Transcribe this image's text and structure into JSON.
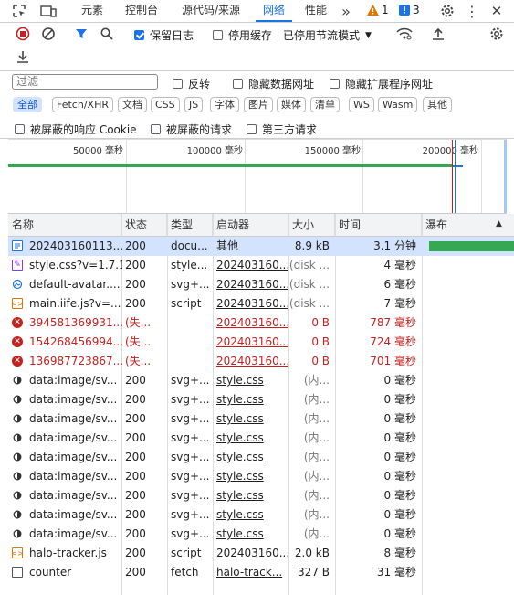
{
  "tabs": [
    {
      "label": "元素"
    },
    {
      "label": "控制台"
    },
    {
      "label": "源代码/来源"
    },
    {
      "label": "网络"
    },
    {
      "label": "性能"
    }
  ],
  "badges": {
    "warnings": "1",
    "issues": "3"
  },
  "toolbar": {
    "preserve_log_label": "保留日志",
    "disable_cache_label": "停用缓存",
    "throttle_label": "已停用节流模式"
  },
  "filter": {
    "placeholder": "过滤",
    "invert_label": "反转",
    "hide_data_urls_label": "隐藏数据网址",
    "hide_ext_urls_label": "隐藏扩展程序网址",
    "chips": [
      "全部",
      "Fetch/XHR",
      "文档",
      "CSS",
      "JS",
      "字体",
      "图片",
      "媒体",
      "清单",
      "WS",
      "Wasm",
      "其他"
    ],
    "blocked_cookies_label": "被屏蔽的响应 Cookie",
    "blocked_requests_label": "被屏蔽的请求",
    "third_party_label": "第三方请求"
  },
  "overview": {
    "ticks": [
      "50000 毫秒",
      "100000 毫秒",
      "150000 毫秒",
      "200000 毫秒"
    ]
  },
  "table": {
    "columns": [
      "名称",
      "状态",
      "类型",
      "启动器",
      "大小",
      "时间",
      "瀑布"
    ],
    "rows": [
      {
        "icon": "document-icon",
        "name": "202403160113...",
        "status": "200",
        "type": "docu...",
        "initiator": "其他",
        "size": "8.9 kB",
        "time": "3.1 分钟",
        "kind": "doc"
      },
      {
        "icon": "stylesheet-icon",
        "name": "style.css?v=1.7.1",
        "status": "200",
        "type": "style...",
        "initiator": "202403160...",
        "size": "(disk ...",
        "time": "4 毫秒",
        "kind": "css"
      },
      {
        "icon": "image-icon",
        "name": "default-avatar....",
        "status": "200",
        "type": "svg+...",
        "initiator": "202403160...",
        "size": "(disk ...",
        "time": "6 毫秒",
        "kind": "img"
      },
      {
        "icon": "script-icon",
        "name": "main.iife.js?v=...",
        "status": "200",
        "type": "script",
        "initiator": "202403160...",
        "size": "(disk ...",
        "time": "7 毫秒",
        "kind": "js"
      },
      {
        "icon": "error-icon",
        "name": "394581369931...",
        "status": "(失...",
        "type": "",
        "initiator": "202403160...",
        "size": "0 B",
        "time": "787 毫秒",
        "kind": "err"
      },
      {
        "icon": "error-icon",
        "name": "154268456994...",
        "status": "(失...",
        "type": "",
        "initiator": "202403160...",
        "size": "0 B",
        "time": "724 毫秒",
        "kind": "err"
      },
      {
        "icon": "error-icon",
        "name": "136987723867...",
        "status": "(失...",
        "type": "",
        "initiator": "202403160...",
        "size": "0 B",
        "time": "701 毫秒",
        "kind": "err"
      },
      {
        "icon": "svg-data-icon",
        "name": "data:image/sv...",
        "status": "200",
        "type": "svg+...",
        "initiator": "style.css",
        "size": "(内...",
        "time": "0 毫秒",
        "kind": "data"
      },
      {
        "icon": "svg-data-icon",
        "name": "data:image/sv...",
        "status": "200",
        "type": "svg+...",
        "initiator": "style.css",
        "size": "(内...",
        "time": "0 毫秒",
        "kind": "data"
      },
      {
        "icon": "svg-data-icon",
        "name": "data:image/sv...",
        "status": "200",
        "type": "svg+...",
        "initiator": "style.css",
        "size": "(内...",
        "time": "0 毫秒",
        "kind": "data"
      },
      {
        "icon": "svg-data-icon",
        "name": "data:image/sv...",
        "status": "200",
        "type": "svg+...",
        "initiator": "style.css",
        "size": "(内...",
        "time": "0 毫秒",
        "kind": "data"
      },
      {
        "icon": "svg-data-icon",
        "name": "data:image/sv...",
        "status": "200",
        "type": "svg+...",
        "initiator": "style.css",
        "size": "(内...",
        "time": "0 毫秒",
        "kind": "data"
      },
      {
        "icon": "svg-data-icon",
        "name": "data:image/sv...",
        "status": "200",
        "type": "svg+...",
        "initiator": "style.css",
        "size": "(内...",
        "time": "0 毫秒",
        "kind": "data"
      },
      {
        "icon": "svg-data-icon",
        "name": "data:image/sv...",
        "status": "200",
        "type": "svg+...",
        "initiator": "style.css",
        "size": "(内...",
        "time": "0 毫秒",
        "kind": "data"
      },
      {
        "icon": "svg-data-icon",
        "name": "data:image/sv...",
        "status": "200",
        "type": "svg+...",
        "initiator": "style.css",
        "size": "(内...",
        "time": "0 毫秒",
        "kind": "data"
      },
      {
        "icon": "svg-data-icon",
        "name": "data:image/sv...",
        "status": "200",
        "type": "svg+...",
        "initiator": "style.css",
        "size": "(内...",
        "time": "0 毫秒",
        "kind": "data"
      },
      {
        "icon": "script-icon",
        "name": "halo-tracker.js",
        "status": "200",
        "type": "script",
        "initiator": "202403160...",
        "size": "2.0 kB",
        "time": "8 毫秒",
        "kind": "js"
      },
      {
        "icon": "fetch-icon",
        "name": "counter",
        "status": "200",
        "type": "fetch",
        "initiator": "halo-track...",
        "size": "327 B",
        "time": "31 毫秒",
        "kind": "fetch"
      }
    ]
  }
}
